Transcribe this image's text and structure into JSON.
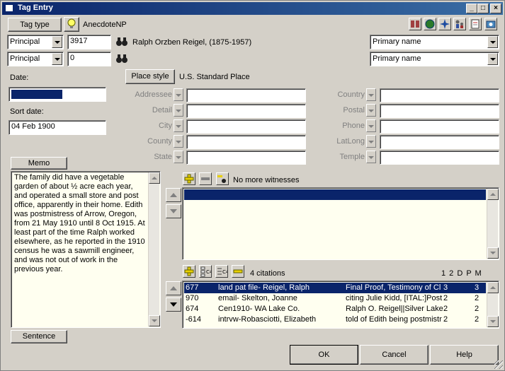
{
  "window": {
    "title": "Tag Entry"
  },
  "tag_type": {
    "button": "Tag type",
    "value": "AnecdoteNP"
  },
  "principals": [
    {
      "role": "Principal",
      "id": "3917",
      "name": "Ralph Orzben Reigel, (1875-1957)",
      "name_type": "Primary name"
    },
    {
      "role": "Principal",
      "id": "0",
      "name": "",
      "name_type": "Primary name"
    }
  ],
  "date": {
    "label": "Date:",
    "value": ""
  },
  "sort_date": {
    "label": "Sort date:",
    "value": "04 Feb 1900"
  },
  "place": {
    "button": "Place style",
    "value": "U.S. Standard Place"
  },
  "address_left": [
    "Addressee",
    "Detail",
    "City",
    "County",
    "State"
  ],
  "address_right": [
    "Country",
    "Postal",
    "Phone",
    "LatLong",
    "Temple"
  ],
  "memo": {
    "button": "Memo",
    "text": "The family did have a vegetable garden of about ½ acre each year, and operated a small store and post office, apparently in their home. Edith was postmistress of Arrow, Oregon, from 21 May 1910 until 8 Oct 1915. At least part of the time Ralph worked elsewhere, as he reported in the 1910 census he was a sawmill engineer, and was not out of work in the previous year."
  },
  "sentence_button": "Sentence",
  "witnesses": {
    "status": "No more witnesses"
  },
  "citations": {
    "count_label": "4  citations",
    "columns_label": "1 2 D P M",
    "rows": [
      {
        "id": "677",
        "source": "land pat file- Reigel, Ralph",
        "detail": "Final Proof, Testimony of Cl",
        "q": "3",
        "m": "3"
      },
      {
        "id": "970",
        "source": "email- Skelton, Joanne",
        "detail": "citing Julie Kidd, [ITAL:]Post",
        "q": "2",
        "m": "2"
      },
      {
        "id": "674",
        "source": "Cen1910- WA Lake Co.",
        "detail": "Ralph O. Reigel||Silver Lake",
        "q": "2",
        "m": "2"
      },
      {
        "id": "-614",
        "source": "intrvw-Robasciotti, Elizabeth",
        "detail": "told of Edith being postmistr",
        "q": "2",
        "m": "2"
      }
    ]
  },
  "buttons": {
    "ok": "OK",
    "cancel": "Cancel",
    "help": "Help"
  },
  "icons": {
    "title_controls": [
      "minimize-icon",
      "maximize-icon",
      "close-icon"
    ],
    "toolbar": [
      "family-icon",
      "globe-icon",
      "compass-icon",
      "people-icon",
      "notepad-icon",
      "camera-icon"
    ]
  }
}
